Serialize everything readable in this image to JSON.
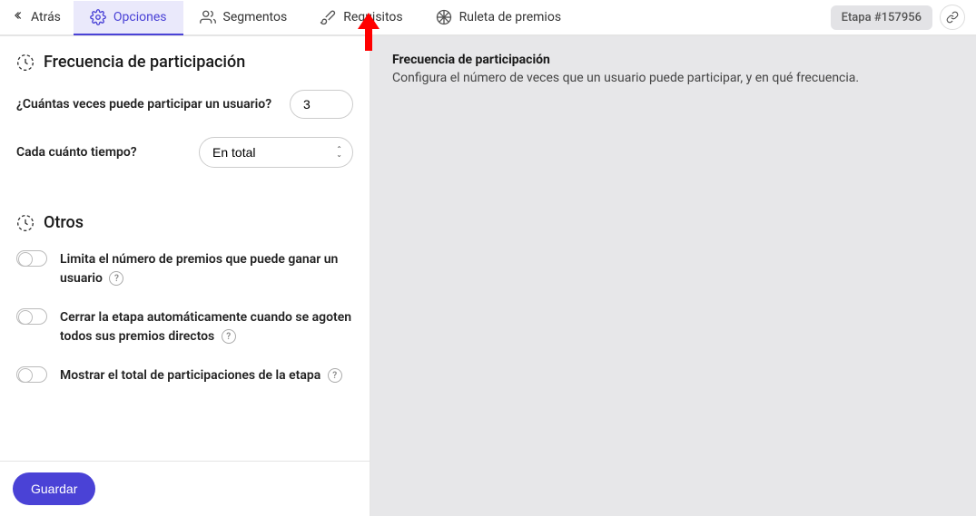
{
  "header": {
    "back": "Atrás",
    "tabs": {
      "opciones": "Opciones",
      "segmentos": "Segmentos",
      "requisitos": "Requisitos",
      "ruleta": "Ruleta de premios"
    },
    "stage_badge": "Etapa #157956"
  },
  "left": {
    "section1_title": "Frecuencia de participación",
    "q_times": "¿Cuántas veces puede participar un usuario?",
    "times_value": "3",
    "q_freq": "Cada cuánto tiempo?",
    "freq_value": "En total",
    "section2_title": "Otros",
    "toggle1": "Limita el número de premios que puede ganar un usuario",
    "toggle2": "Cerrar la etapa automáticamente cuando se agoten todos sus premios directos",
    "toggle3": "Mostrar el total de participaciones de la etapa",
    "save": "Guardar"
  },
  "right": {
    "title": "Frecuencia de participación",
    "desc": "Configura el número de veces que un usuario puede participar, y en qué frecuencia."
  }
}
